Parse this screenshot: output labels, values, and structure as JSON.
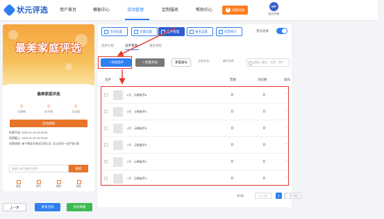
{
  "app": {
    "name": "状元评选"
  },
  "nav": {
    "items": [
      "用户首页",
      "模板中心",
      "活动管理",
      "定制服务",
      "帮助中心"
    ],
    "active": "活动管理",
    "create_label": "创建活动",
    "vip_badge": "VIP",
    "vip_label": "会员升级"
  },
  "phone": {
    "banner_title": "最美家庭评选",
    "card_title": "最美家庭评选",
    "stats": [
      {
        "num": "0",
        "label": "总票数"
      },
      {
        "num": "0",
        "label": "选手数"
      },
      {
        "num": "0",
        "label": "访问量"
      }
    ],
    "rule_btn": "活动规则",
    "info": [
      "投票开始: 2020-01-16 15:03:49",
      "投票截止: 2020-01-22 15:03:49",
      "投票规则: 每个微信号每天可投1次, 可以对同一选手投1票"
    ],
    "search_placeholder": "请输入选手编号/名称",
    "search_btn": "搜索",
    "tabs": [
      "首页",
      "排行",
      "规则",
      "报名"
    ]
  },
  "bottom_buttons": {
    "prev": "上一步",
    "publish": "发布活动",
    "preview": "活动海报"
  },
  "toolbar": {
    "buttons": [
      "活动设置",
      "页面设置",
      "选手管理",
      "报名设置",
      "投票统计"
    ],
    "active": "选手管理",
    "preview_label": "预览效果"
  },
  "subtabs": {
    "items": [
      "选手分组",
      "选手管理",
      "报名审核"
    ],
    "active": "选手管理"
  },
  "actions": {
    "add": "+ 添加选手",
    "bulk": "+ 批量添加",
    "reset": "重置编号",
    "filter_status": "全部状态",
    "filter_sort": "编号排序",
    "search_placeholder": "请输入编号、名称、简介"
  },
  "table": {
    "headers": {
      "player": "选手",
      "votes": "票数",
      "reach": "浏览数",
      "ops": "操作"
    },
    "rows": [
      {
        "num": "6号",
        "name": "示例选手6",
        "votes": "0",
        "reach": "0",
        "ops": "···"
      },
      {
        "num": "5号",
        "name": "示例选手5",
        "votes": "0",
        "reach": "0",
        "ops": "···"
      },
      {
        "num": "4号",
        "name": "示例选手4",
        "votes": "0",
        "reach": "0",
        "ops": "···"
      },
      {
        "num": "3号",
        "name": "示例选手3",
        "votes": "0",
        "reach": "0",
        "ops": "···"
      },
      {
        "num": "2号",
        "name": "示例选手2",
        "votes": "0",
        "reach": "0",
        "ops": "···"
      },
      {
        "num": "1号",
        "name": "示例选手1",
        "votes": "0",
        "reach": "0",
        "ops": "···"
      }
    ]
  },
  "pager": {
    "total": "共6条",
    "prev": "上一页",
    "page": "1",
    "next": "下一页"
  },
  "colors": {
    "primary": "#2f7ff0",
    "accent_orange": "#ff7d20",
    "annotation_red": "#e8342c"
  }
}
